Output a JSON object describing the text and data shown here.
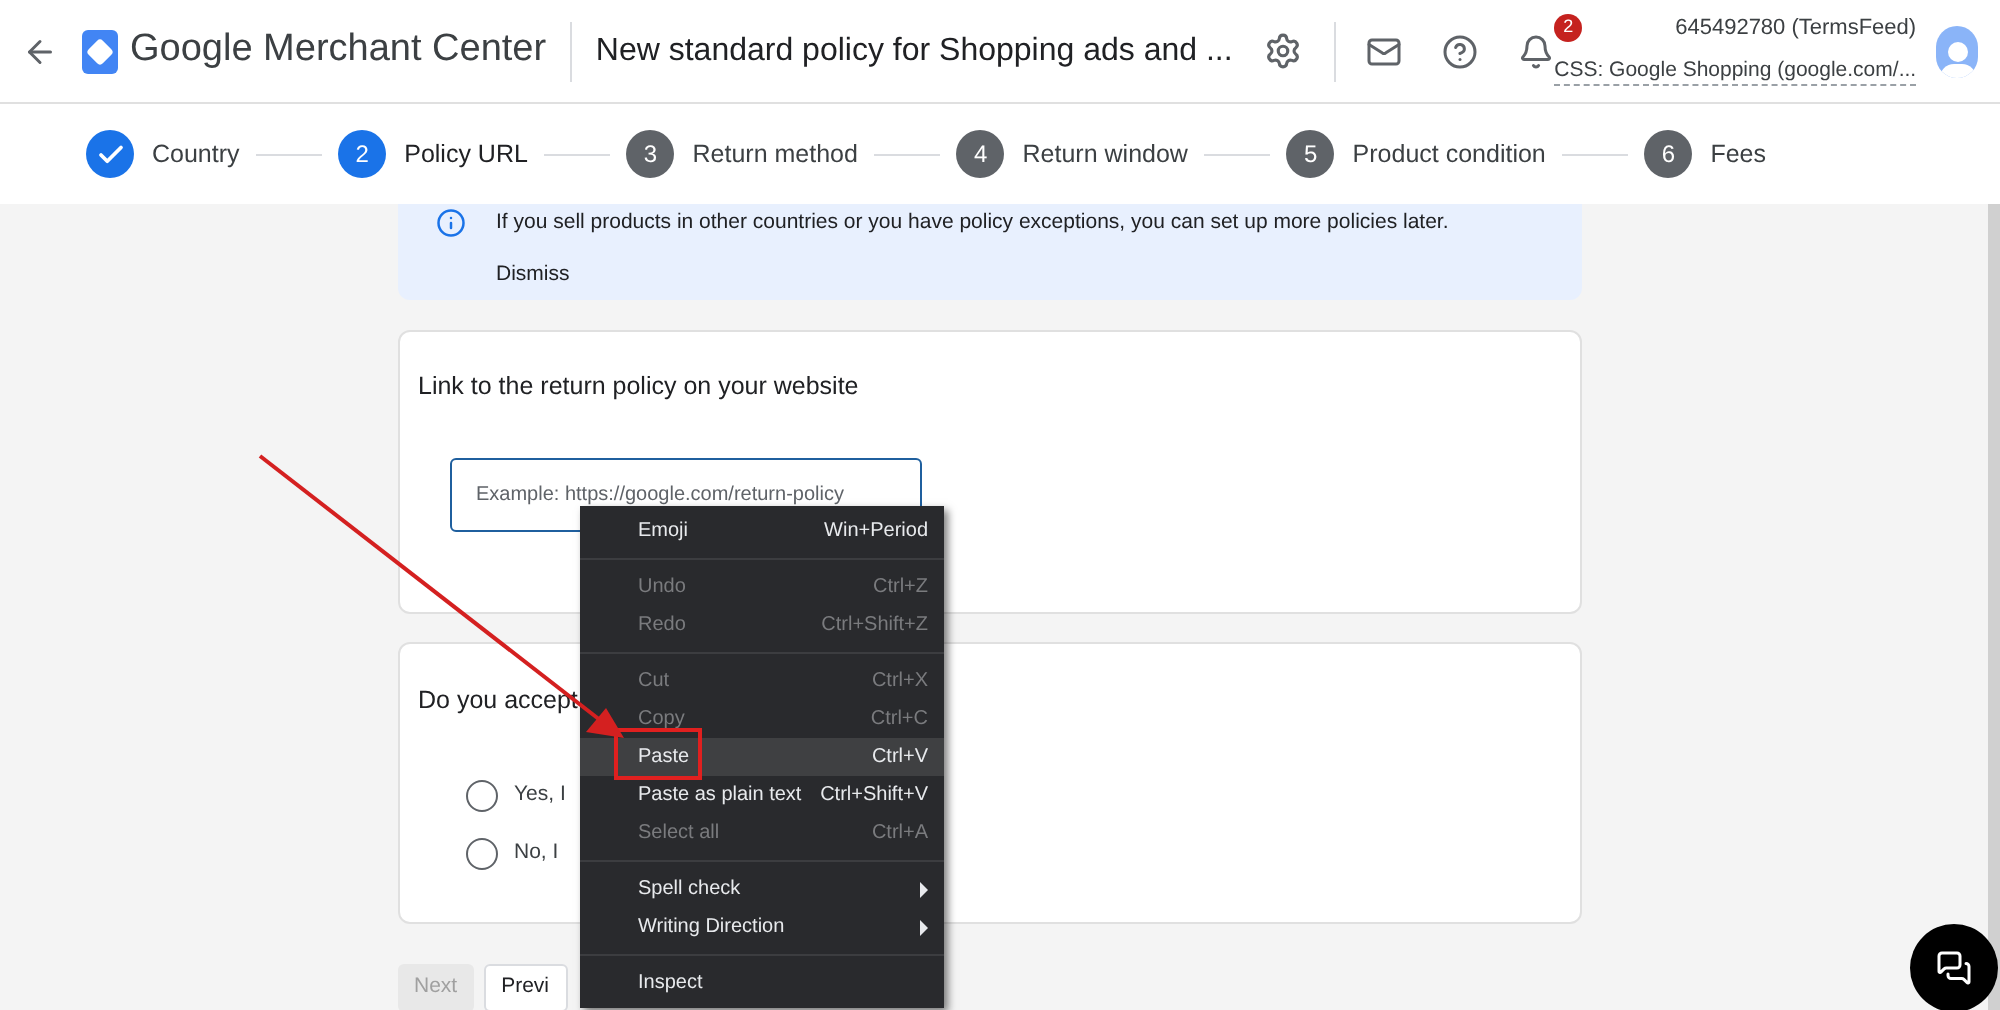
{
  "header": {
    "app_name": "Google Merchant Center",
    "page_title": "New standard policy for Shopping ads and ...",
    "notification_count": "2",
    "account_id": "645492780 (TermsFeed)",
    "account_subtitle": "CSS: Google Shopping (google.com/..."
  },
  "steps": [
    {
      "label": "Country",
      "done": true,
      "selected": false
    },
    {
      "number": "2",
      "label": "Policy URL",
      "done": false,
      "selected": true
    },
    {
      "number": "3",
      "label": "Return method",
      "done": false,
      "selected": false
    },
    {
      "number": "4",
      "label": "Return window",
      "done": false,
      "selected": false
    },
    {
      "number": "5",
      "label": "Product condition",
      "done": false,
      "selected": false
    },
    {
      "number": "6",
      "label": "Fees",
      "done": false,
      "selected": false
    }
  ],
  "notice": {
    "text": "If you sell products in other countries or you have policy exceptions, you can set up more policies later.",
    "action": "Dismiss"
  },
  "link_card": {
    "title": "Link to the return policy on your website",
    "placeholder": "Example: https://google.com/return-policy"
  },
  "question_card": {
    "title": "Do you accept",
    "options": [
      {
        "label": "Yes, I",
        "selected": false
      },
      {
        "label": "No, I",
        "selected": false
      }
    ]
  },
  "buttons": [
    {
      "label": "Next",
      "disabled": true
    },
    {
      "label": "Previ",
      "disabled": false
    }
  ],
  "context_menu": [
    {
      "kind": "item",
      "label": "Emoji",
      "shortcut": "Win+Period",
      "disabled": false,
      "selected": false
    },
    {
      "kind": "separator"
    },
    {
      "kind": "item",
      "label": "Undo",
      "shortcut": "Ctrl+Z",
      "disabled": true,
      "selected": false
    },
    {
      "kind": "item",
      "label": "Redo",
      "shortcut": "Ctrl+Shift+Z",
      "disabled": true,
      "selected": false
    },
    {
      "kind": "separator"
    },
    {
      "kind": "item",
      "label": "Cut",
      "shortcut": "Ctrl+X",
      "disabled": true,
      "selected": false
    },
    {
      "kind": "item",
      "label": "Copy",
      "shortcut": "Ctrl+C",
      "disabled": true,
      "selected": false
    },
    {
      "kind": "item",
      "label": "Paste",
      "shortcut": "Ctrl+V",
      "disabled": false,
      "selected": true
    },
    {
      "kind": "item",
      "label": "Paste as plain text",
      "shortcut": "Ctrl+Shift+V",
      "disabled": false,
      "selected": false
    },
    {
      "kind": "item",
      "label": "Select all",
      "shortcut": "Ctrl+A",
      "disabled": true,
      "selected": false
    },
    {
      "kind": "separator"
    },
    {
      "kind": "submenu",
      "label": "Spell check",
      "disabled": false,
      "selected": false
    },
    {
      "kind": "submenu",
      "label": "Writing Direction",
      "disabled": false,
      "selected": false
    },
    {
      "kind": "separator"
    },
    {
      "kind": "item",
      "label": "Inspect",
      "disabled": false,
      "selected": false
    }
  ]
}
